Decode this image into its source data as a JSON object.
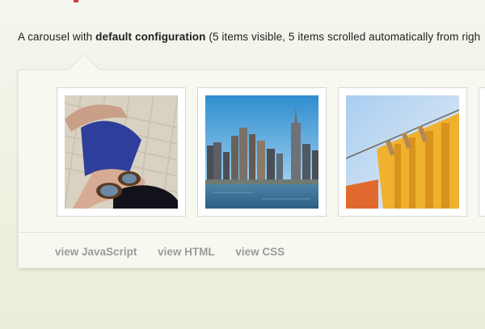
{
  "intro": {
    "text_before": "A carousel with ",
    "bold": "default configuration",
    "text_after": " (5 items visible, 5 items scrolled automatically from righ"
  },
  "carousel": {
    "items": [
      {
        "label": "woman-in-hammock-photo"
      },
      {
        "label": "city-skyline-photo"
      },
      {
        "label": "laundry-clothesline-photo"
      },
      {
        "label": "next-photo-partial"
      }
    ]
  },
  "links": {
    "javascript": "view JavaScript",
    "html": "view HTML",
    "css": "view CSS"
  },
  "colors": {
    "accent_red": "#d23a4a",
    "link_gray": "#9a9a9a"
  }
}
